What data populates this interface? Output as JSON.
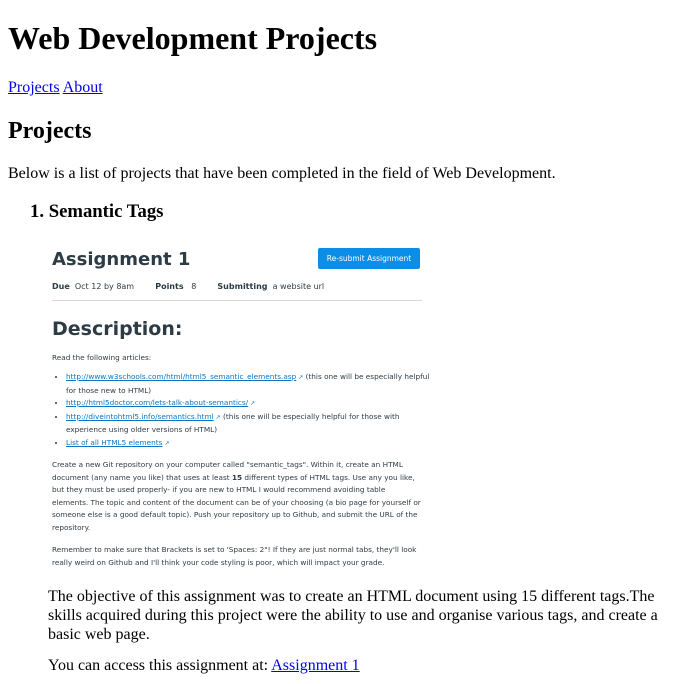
{
  "page": {
    "title": "Web Development Projects",
    "nav": [
      "Projects",
      "About"
    ],
    "section_heading": "Projects",
    "intro": "Below is a list of projects that have been completed in the field of Web Development.",
    "project": {
      "number": "1.",
      "title": "Semantic Tags",
      "paragraph": "The objective of this assignment was to create an HTML document using 15 different tags.The skills acquired during this project were the ability to use and organise various tags, and create a basic web page.",
      "access_prefix": "You can access this assignment at: ",
      "access_link": "Assignment 1"
    }
  },
  "screenshot": {
    "assignment_title": "Assignment 1",
    "resubmit_label": "Re-submit Assignment",
    "due_label": "Due",
    "due_value": "Oct 12 by 8am",
    "points_label": "Points",
    "points_value": "8",
    "submitting_label": "Submitting",
    "submitting_value": "a website url",
    "description_heading": "Description:",
    "read_label": "Read the following articles:",
    "links": [
      {
        "link": "http://www.w3schools.com/html/html5_semantic_elements.asp",
        "note": "(this one will be especially helpful for those new to HTML)"
      },
      {
        "link": "http://html5doctor.com/lets-talk-about-semantics/",
        "note": ""
      },
      {
        "link": "http://diveintohtml5.info/semantics.html",
        "note": "(this one will be especially helpful for those with experience using older versions of HTML)"
      },
      {
        "link": "List of all HTML5 elements",
        "note": ""
      }
    ],
    "instructions_pre": "Create a new Git repository on your computer called \"semantic_tags\". Within it, create an HTML document (any name you like) that uses at least ",
    "instructions_num": "15",
    "instructions_post": " different types of HTML tags. Use any you like, but they must be used properly- if you are new to HTML I would recommend avoiding table elements. The topic and content of the document can be of your choosing (a bio page for yourself or someone else is a good default topic). Push your repository up to Github, and submit the URL of the repository.",
    "reminder": "Remember to make sure that Brackets is set to 'Spaces: 2\"! If they are just normal tabs, they'll look really weird on Github and I'll think your code styling is poor, which will impact your grade."
  }
}
